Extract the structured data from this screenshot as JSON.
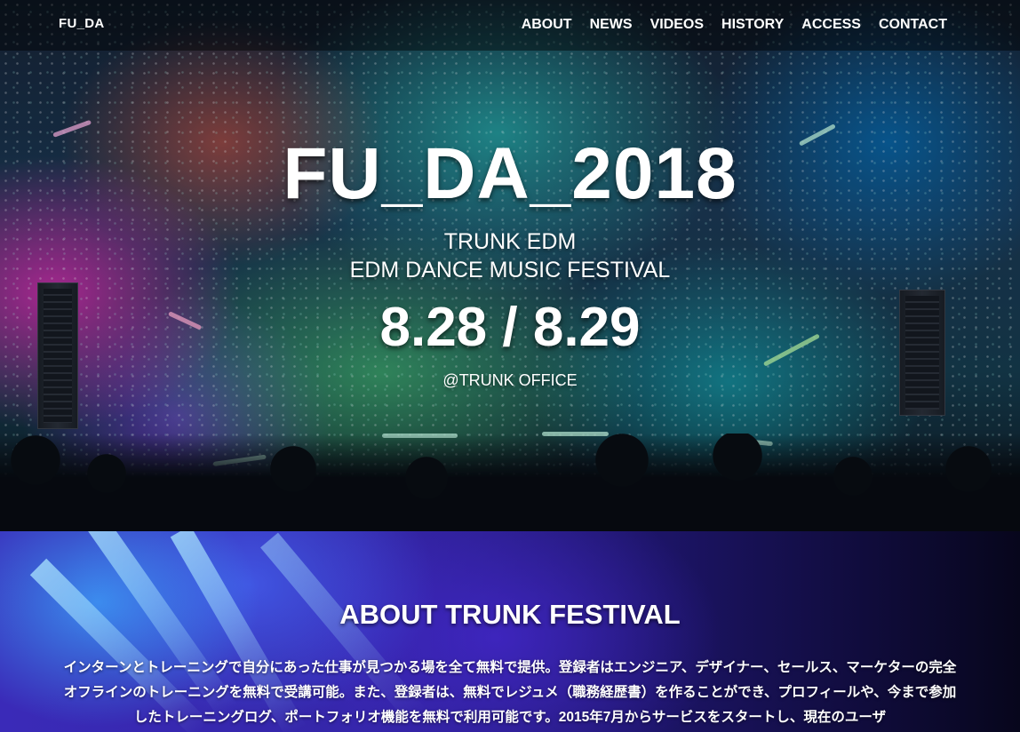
{
  "nav": {
    "logo": "FU_DA",
    "links": [
      "ABOUT",
      "NEWS",
      "VIDEOS",
      "HISTORY",
      "ACCESS",
      "CONTACT"
    ]
  },
  "hero": {
    "title": "FU_DA_2018",
    "subtitle_1": "TRUNK EDM",
    "subtitle_2": "EDM DANCE MUSIC FESTIVAL",
    "date": "8.28 / 8.29",
    "venue": "@TRUNK OFFICE",
    "background": "festival-stage-crowd-image"
  },
  "about": {
    "title": "ABOUT TRUNK FESTIVAL",
    "body": "インターンとトレーニングで自分にあった仕事が見つかる場を全て無料で提供。登録者はエンジニア、デザイナー、セールス、マーケターの完全オフラインのトレーニングを無料で受講可能。また、登録者は、無料でレジュメ（職務経歴書）を作ることができ、プロフィールや、今まで参加したトレーニングログ、ポートフォリオ機能を無料で利用可能です。2015年7月からサービスをスタートし、現在のユーザ",
    "background": "stage-lights-image"
  }
}
